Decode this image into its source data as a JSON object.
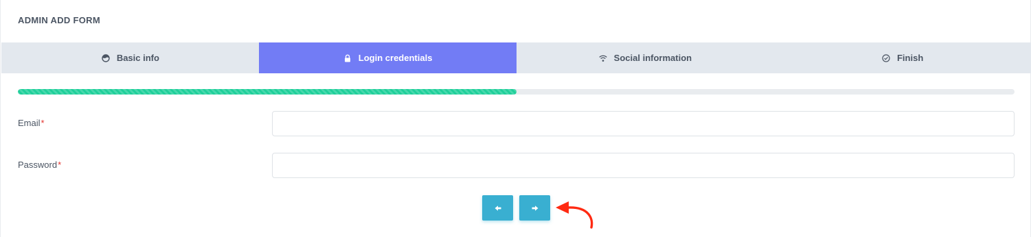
{
  "header": {
    "title": "ADMIN ADD FORM"
  },
  "tabs": [
    {
      "label": "Basic info",
      "icon": "face-icon",
      "active": false
    },
    {
      "label": "Login credentials",
      "icon": "lock-icon",
      "active": true
    },
    {
      "label": "Social information",
      "icon": "wifi-icon",
      "active": false
    },
    {
      "label": "Finish",
      "icon": "check-circle-icon",
      "active": false
    }
  ],
  "progress": {
    "value_percent": 50,
    "color": "#1fcf9a"
  },
  "form": {
    "email": {
      "label": "Email",
      "required_mark": "*",
      "value": "",
      "placeholder": ""
    },
    "password": {
      "label": "Password",
      "required_mark": "*",
      "value": "",
      "placeholder": ""
    }
  },
  "buttons": {
    "previous": {
      "icon": "arrow-left-icon"
    },
    "next": {
      "icon": "arrow-right-icon"
    }
  },
  "annotation": {
    "icon": "curved-arrow-icon",
    "color": "#ff2a12"
  },
  "colors": {
    "accent": "#727cf5",
    "button": "#39afd1",
    "tabs_bg": "#e3e8ee",
    "required": "#e3342f"
  }
}
